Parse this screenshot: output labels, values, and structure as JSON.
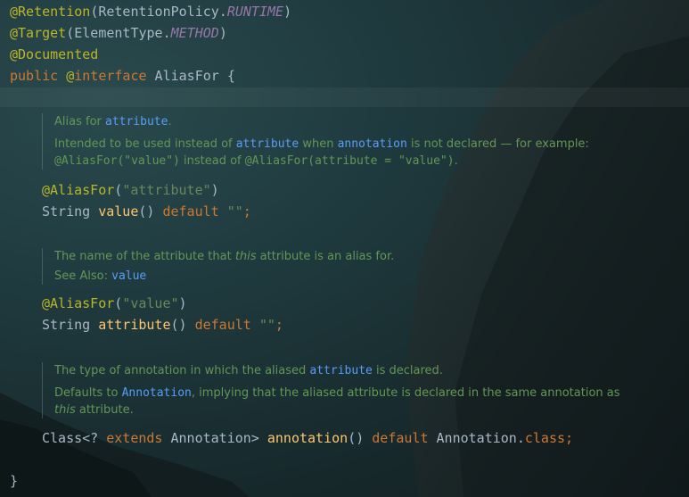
{
  "header_lines": {
    "retention": {
      "at": "@Retention",
      "open": "(RetentionPolicy.",
      "const": "RUNTIME",
      "close": ")"
    },
    "target": {
      "at": "@Target",
      "open": "(ElementType.",
      "const": "METHOD",
      "close": ")"
    },
    "documented": {
      "at": "@Documented"
    },
    "decl": {
      "public": "public ",
      "at": "@",
      "interface": "interface",
      "name": " AliasFor {"
    }
  },
  "doc1": {
    "l1_pre": "Alias for ",
    "l1_link": "attribute",
    "l1_post": ".",
    "l2_pre": "Intended to be used instead of ",
    "l2_link1": "attribute",
    "l2_mid": " when ",
    "l2_link2": "annotation",
    "l2_post": " is not declared — for example:",
    "l3_code1": "@AliasFor(\"value\")",
    "l3_mid": " instead of ",
    "l3_code2": "@AliasFor(attribute = \"value\")",
    "l3_post": "."
  },
  "method1": {
    "ann": "@AliasFor",
    "open": "(",
    "str": "\"attribute\"",
    "close": ")",
    "type": "String ",
    "name": "value",
    "parens": "() ",
    "default": "default",
    "space": " ",
    "val": "\"\"",
    "semi": ";"
  },
  "doc2": {
    "l1_pre": "The name of the attribute that ",
    "l1_em": "this",
    "l1_post": " attribute is an alias for.",
    "l2_pre": "See Also: ",
    "l2_link": "value"
  },
  "method2": {
    "ann": "@AliasFor",
    "open": "(",
    "str": "\"value\"",
    "close": ")",
    "type": "String ",
    "name": "attribute",
    "parens": "() ",
    "default": "default",
    "space": " ",
    "val": "\"\"",
    "semi": ";"
  },
  "doc3": {
    "l1_pre": "The type of annotation in which the aliased ",
    "l1_link": "attribute",
    "l1_post": " is declared.",
    "l2_pre": "Defaults to ",
    "l2_link": "Annotation",
    "l2_post": ", implying that the aliased attribute is declared in the same annotation as",
    "l3_em": "this",
    "l3_post": " attribute."
  },
  "method3": {
    "type": "Class<? ",
    "extends": "extends",
    "type2": " Annotation> ",
    "name": "annotation",
    "parens": "() ",
    "default": "default",
    "ret": " Annotation.",
    "cls": "class",
    "semi": ";"
  },
  "closing_brace": "}",
  "colors": {
    "annotation": "#bbb529",
    "keyword": "#cc7832",
    "constant": "#9876aa",
    "string": "#6a8759",
    "method": "#ffc66d",
    "doc": "#629755",
    "doc_link": "#589df6"
  }
}
